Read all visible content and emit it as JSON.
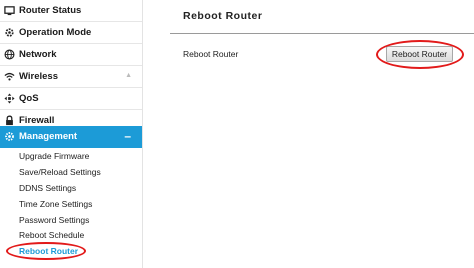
{
  "sidebar": {
    "items": [
      {
        "label": "Router Status",
        "icon": "monitor-icon"
      },
      {
        "label": "Operation Mode",
        "icon": "gear-cycle-icon"
      },
      {
        "label": "Network",
        "icon": "globe-icon"
      },
      {
        "label": "Wireless",
        "icon": "wifi-icon",
        "indicator": "▲"
      },
      {
        "label": "QoS",
        "icon": "qos-icon"
      },
      {
        "label": "Firewall",
        "icon": "lock-icon"
      },
      {
        "label": "Management",
        "icon": "gear-icon",
        "indicator": "–",
        "expanded": true
      }
    ],
    "submenu": [
      {
        "label": "Upgrade Firmware"
      },
      {
        "label": "Save/Reload Settings"
      },
      {
        "label": "DDNS Settings"
      },
      {
        "label": "Time Zone Settings"
      },
      {
        "label": "Password Settings"
      },
      {
        "label": "Reboot Schedule"
      },
      {
        "label": "Reboot Router",
        "active": true
      }
    ]
  },
  "main": {
    "title": "Reboot Router",
    "row_label": "Reboot Router",
    "button_label": "Reboot Router"
  },
  "colors": {
    "accent": "#1c9bd7",
    "highlight_oval": "#e21a1a"
  }
}
